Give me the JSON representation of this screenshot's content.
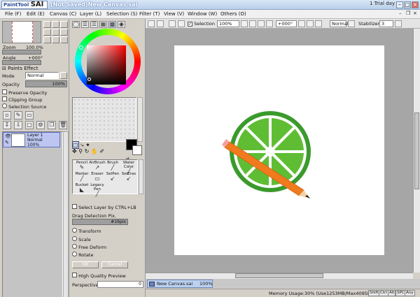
{
  "app": {
    "logo_text": "PaintTool",
    "logo_big": "SAI",
    "window_title": "(Not Saved)New Canvas.sai",
    "trial_text": "1 Trial day"
  },
  "menu": [
    "File (F)",
    "Edit (E)",
    "Canvas (C)",
    "Layer (L)",
    "Selection (S)",
    "Filter (T)",
    "View (V)",
    "Window (W)",
    "Others (O)"
  ],
  "navigator": {
    "zoom_label": "Zoom",
    "zoom_value": "100.0%",
    "angle_label": "Angle",
    "angle_value": "+000°"
  },
  "layer_props": {
    "paints_effect": "Paints Effect",
    "mode_label": "Mode",
    "mode_value": "Normal",
    "opacity_label": "Opacity",
    "opacity_value": "100%",
    "opacity_level": 1.0,
    "preserve_opacity": "Preserve Opacity",
    "clipping_group": "Clipping Group",
    "selection_source": "Selection Source"
  },
  "layer": {
    "name": "Layer 1",
    "mode": "Normal",
    "opacity": "100%"
  },
  "colors": {
    "primary": "#000000",
    "secondary": "#ffffff",
    "picked": "#7a0f1a"
  },
  "tools": [
    {
      "label": "Pencil",
      "icon": "pencil-icon",
      "glyph": "✎"
    },
    {
      "label": "AirBrush",
      "icon": "airbrush-icon",
      "glyph": "↗"
    },
    {
      "label": "Brush",
      "icon": "brush-icon",
      "glyph": "╱"
    },
    {
      "label": "Water Color",
      "icon": "watercolor-icon",
      "glyph": "╱"
    },
    {
      "label": "Marker",
      "icon": "marker-icon",
      "glyph": "╱"
    },
    {
      "label": "Eraser",
      "icon": "eraser-icon",
      "glyph": "▭"
    },
    {
      "label": "SelPen",
      "icon": "selpen-icon",
      "glyph": "↙"
    },
    {
      "label": "SelEras",
      "icon": "seleras-icon",
      "glyph": "↙"
    },
    {
      "label": "Bucket",
      "icon": "bucket-icon",
      "glyph": "◣"
    },
    {
      "label": "Legacy Pen",
      "icon": "legacy-pen-icon",
      "glyph": "╱"
    }
  ],
  "options": {
    "select_layer": "Select Layer by CTRL+LB",
    "drag_detection": "Drag Detection Pix.",
    "drag_value": "#16pix",
    "transform": "Transform",
    "scale": "Scale",
    "free_deform": "Free Deform",
    "rotate": "Rotate",
    "ok": "OK",
    "cancel": "Cancel",
    "high_quality": "High Quality Preview",
    "perspective": "Perspective",
    "perspective_value": "0"
  },
  "canvas_toolbar": {
    "selection": "Selection",
    "zoom": "100%",
    "angle": "+000°",
    "mode": "Normal",
    "stabilizer_label": "Stabilizer",
    "stabilizer_value": "3"
  },
  "document_tab": {
    "name": "New Canvas.sai",
    "zoom": "100%"
  },
  "status": {
    "memory": "Memory Usage:30% (Use1253MB/Max4095MB)",
    "keys": [
      "Shift",
      "Ctrl",
      "Alt",
      "SPC",
      "Any"
    ]
  }
}
